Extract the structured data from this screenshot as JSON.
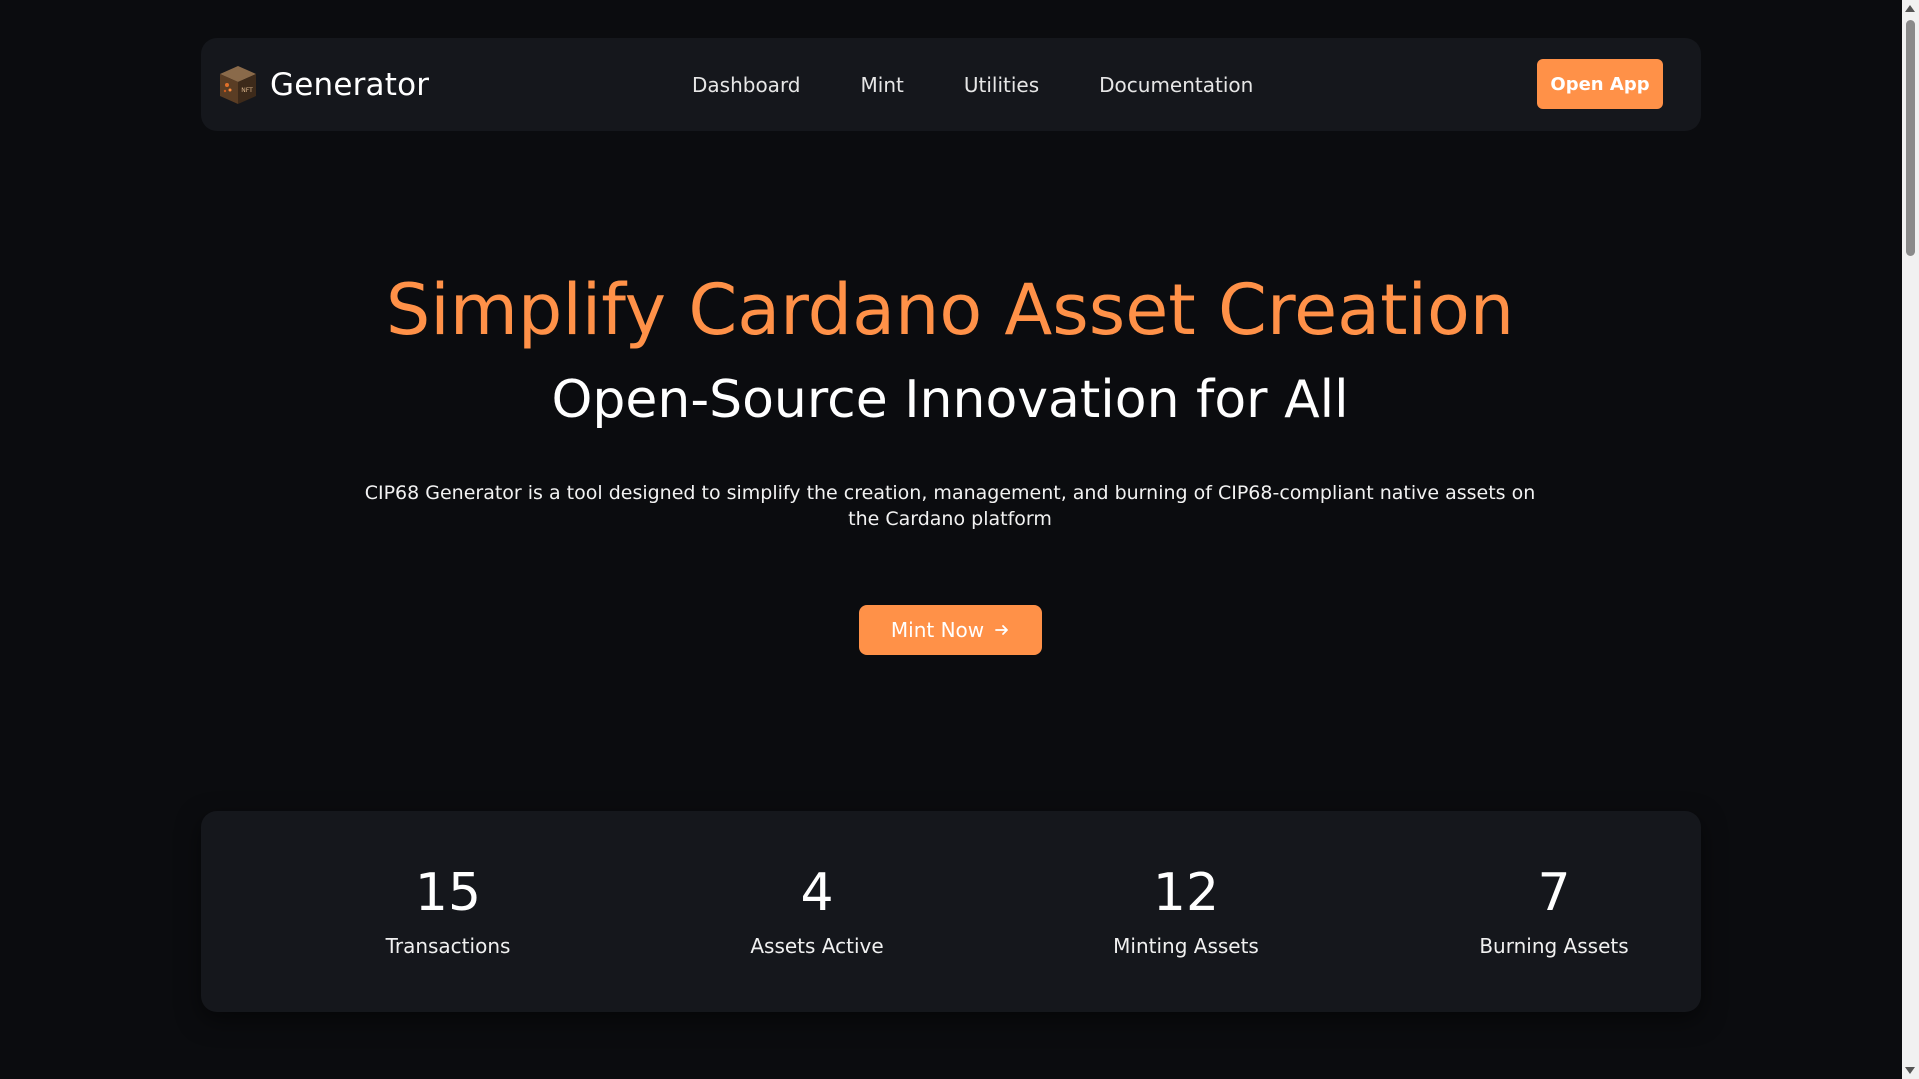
{
  "navbar": {
    "brand": "Generator",
    "logo_icon": "nft-cube-icon",
    "links": [
      {
        "label": "Dashboard"
      },
      {
        "label": "Mint"
      },
      {
        "label": "Utilities"
      },
      {
        "label": "Documentation"
      }
    ],
    "open_app_label": "Open App"
  },
  "hero": {
    "title": "Simplify Cardano Asset Creation",
    "subtitle": "Open-Source Innovation for All",
    "description": "CIP68 Generator is a tool designed to simplify the creation, management, and burning of CIP68-compliant native assets on the Cardano platform",
    "cta_label": "Mint Now",
    "cta_icon": "arrow-right-icon"
  },
  "stats": [
    {
      "value": "15",
      "label": "Transactions"
    },
    {
      "value": "4",
      "label": "Assets Active"
    },
    {
      "value": "12",
      "label": "Minting Assets"
    },
    {
      "value": "7",
      "label": "Burning Assets"
    }
  ],
  "colors": {
    "background": "#0b0c0f",
    "panel": "#15171c",
    "accent": "#ff9148",
    "text": "#ffffff"
  }
}
